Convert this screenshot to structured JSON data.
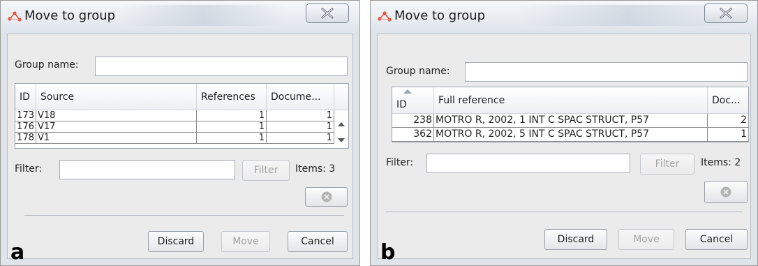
{
  "dialogs": [
    {
      "panel_letter": "a",
      "title": "Move to group",
      "group_label": "Group name:",
      "group_value": "",
      "columns": [
        "ID",
        "Source",
        "References",
        "Docume..."
      ],
      "rows": [
        {
          "id": "173",
          "source": "V18",
          "references": "1",
          "documents": "1"
        },
        {
          "id": "176",
          "source": "V17",
          "references": "1",
          "documents": "1"
        },
        {
          "id": "178",
          "source": "V1",
          "references": "1",
          "documents": "1"
        }
      ],
      "filter_label": "Filter:",
      "filter_value": "",
      "filter_button": "Filter",
      "items_text": "Items: 3",
      "discard_label": "Discard",
      "move_label": "Move",
      "cancel_label": "Cancel"
    },
    {
      "panel_letter": "b",
      "title": "Move to group",
      "group_label": "Group name:",
      "group_value": "",
      "columns": [
        "ID",
        "Full reference",
        "Doc..."
      ],
      "rows": [
        {
          "id": "238",
          "reference": "MOTRO R, 2002, 1 INT C SPAC STRUCT, P57",
          "documents": "2"
        },
        {
          "id": "362",
          "reference": "MOTRO R, 2002, 5 INT C SPAC STRUCT, P57",
          "documents": "1"
        }
      ],
      "filter_label": "Filter:",
      "filter_value": "",
      "filter_button": "Filter",
      "items_text": "Items: 2",
      "discard_label": "Discard",
      "move_label": "Move",
      "cancel_label": "Cancel"
    }
  ],
  "icons": {
    "app": "app-logo-icon",
    "close": "close-icon",
    "clear": "clear-filter-icon",
    "sort": "sort-ascending-icon",
    "scroll_up": "scroll-up-arrow-icon",
    "scroll_down": "scroll-down-arrow-icon"
  },
  "colors": {
    "app_icon": "#e0553d",
    "window_frame": "#dfe4ea",
    "client_bg": "#ebebeb"
  }
}
